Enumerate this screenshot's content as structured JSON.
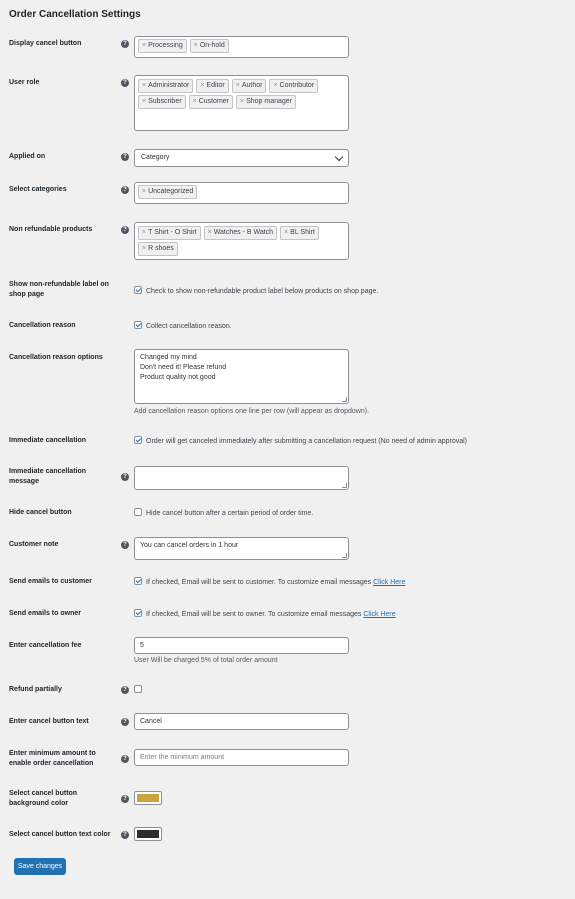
{
  "page_title": "Order Cancellation Settings",
  "help_glyph": "?",
  "display_cancel": {
    "label": "Display cancel button",
    "tags": [
      "Processing",
      "On-hold"
    ]
  },
  "user_role": {
    "label": "User role",
    "tags_row1": [
      "Administrator",
      "Editor",
      "Author",
      "Contributor"
    ],
    "tags_row2": [
      "Subscriber",
      "Customer",
      "Shop manager"
    ]
  },
  "applied_on": {
    "label": "Applied on",
    "value": "Category"
  },
  "select_categories": {
    "label": "Select categories",
    "tags": [
      "Uncategorized"
    ]
  },
  "non_refundable": {
    "label": "Non refundable products",
    "tags_row1": [
      "T Shirt - O Shirt",
      "Watches - B Watch",
      "BL Shirt"
    ],
    "tags_row2": [
      "R shoes"
    ]
  },
  "show_non_refundable": {
    "label": "Show non-refundable label on shop page",
    "checked": true,
    "text": "Check to show non-refundable product label below products on shop page."
  },
  "cancellation_reason": {
    "label": "Cancellation reason",
    "checked": true,
    "text": "Collect cancellation reason."
  },
  "reason_options": {
    "label": "Cancellation reason options",
    "lines": [
      "Changed my mind",
      "Don't need it! Please refund",
      "Product quality not good"
    ],
    "desc": "Add cancellation reason options one line per row (will appear as dropdown)."
  },
  "immediate_cancellation": {
    "label": "Immediate cancellation",
    "checked": true,
    "text": "Order will get canceled immediately after submitting a cancellation request (No need of admin approval)"
  },
  "immediate_message": {
    "label": "Immediate cancellation message",
    "value": ""
  },
  "hide_cancel": {
    "label": "Hide cancel button",
    "checked": false,
    "text": "Hide cancel button after a certain period of order time."
  },
  "customer_note": {
    "label": "Customer note",
    "value": "You can cancel orders in 1 hour"
  },
  "emails_customer": {
    "label": "Send emails to customer",
    "checked": true,
    "text": "If checked, Email will be sent to customer. To customize email messages",
    "link": "Click Here"
  },
  "emails_owner": {
    "label": "Send emails to owner",
    "checked": true,
    "text": "If checked, Email will be sent to owner. To customize email messages",
    "link": "Click Here"
  },
  "cancellation_fee": {
    "label": "Enter cancellation fee",
    "value": "5",
    "desc": "User Will be charged 5% of total order amount"
  },
  "refund_partially": {
    "label": "Refund partially",
    "checked": false
  },
  "cancel_button_text": {
    "label": "Enter cancel button text",
    "value": "Cancel"
  },
  "minimum_amount": {
    "label": "Enter minimum amount to enable order cancellation",
    "placeholder": "Enter the minimum amount"
  },
  "bg_color": {
    "label": "Select cancel button background color",
    "color": "#c9a43f"
  },
  "text_color": {
    "label": "Select cancel button text color",
    "color": "#2c2c2c"
  },
  "save_label": "Save changes",
  "tag_remove_glyph": "×"
}
